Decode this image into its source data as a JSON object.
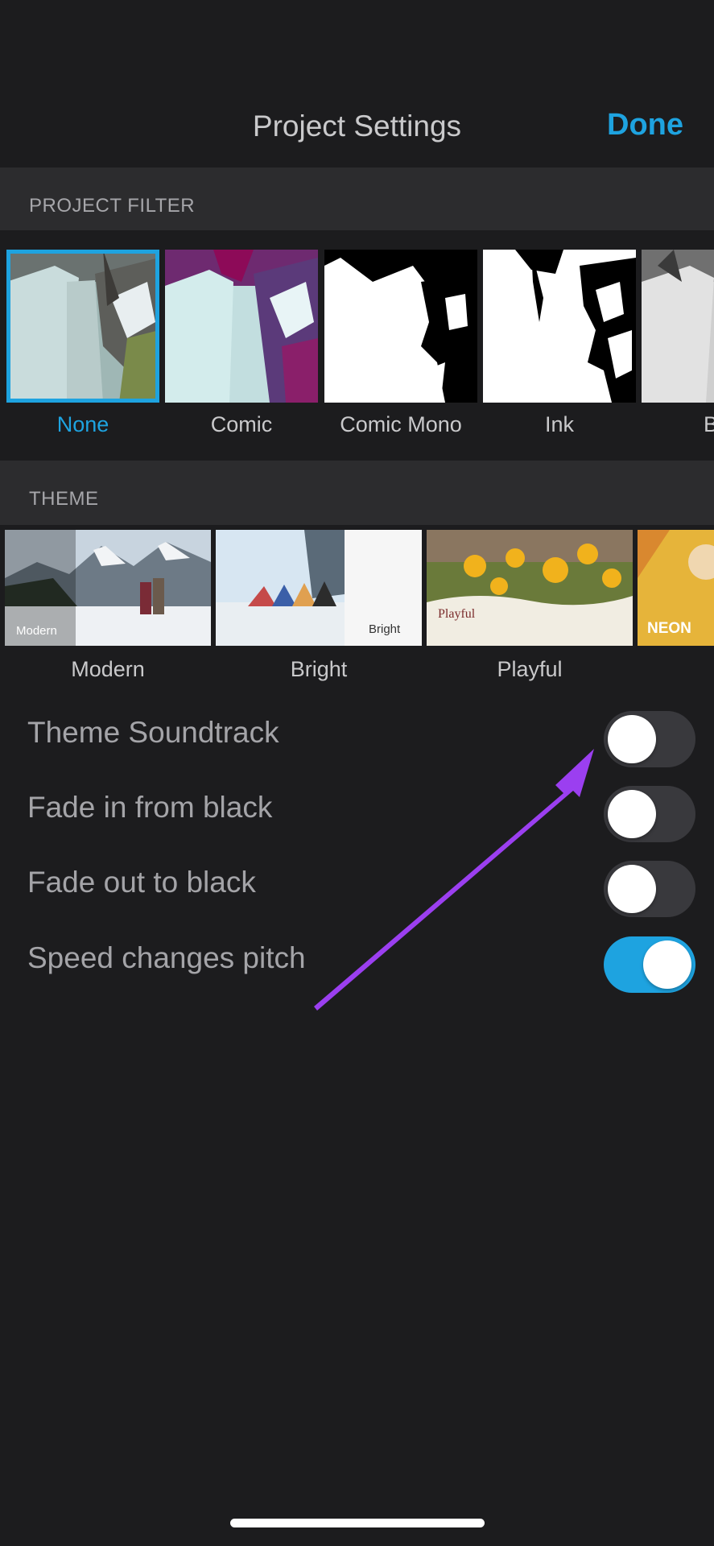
{
  "nav": {
    "title": "Project Settings",
    "done_label": "Done"
  },
  "filter_section": {
    "header": "PROJECT FILTER",
    "items": [
      {
        "label": "None",
        "selected": true
      },
      {
        "label": "Comic",
        "selected": false
      },
      {
        "label": "Comic Mono",
        "selected": false
      },
      {
        "label": "Ink",
        "selected": false
      },
      {
        "label": "B&",
        "selected": false
      }
    ]
  },
  "theme_section": {
    "header": "THEME",
    "items": [
      {
        "label": "Modern",
        "overlay": "Modern"
      },
      {
        "label": "Bright",
        "overlay": "Bright"
      },
      {
        "label": "Playful",
        "overlay": "Playful"
      },
      {
        "label": "",
        "overlay": "NEON"
      }
    ]
  },
  "settings": [
    {
      "label": "Theme Soundtrack",
      "on": false
    },
    {
      "label": "Fade in from black",
      "on": false
    },
    {
      "label": "Fade out to black",
      "on": false
    },
    {
      "label": "Speed changes pitch",
      "on": true
    }
  ],
  "colors": {
    "accent": "#1ea3e0",
    "background": "#1c1c1e",
    "section_header": "#2c2c2e",
    "annotation_arrow": "#9b3ff0"
  }
}
